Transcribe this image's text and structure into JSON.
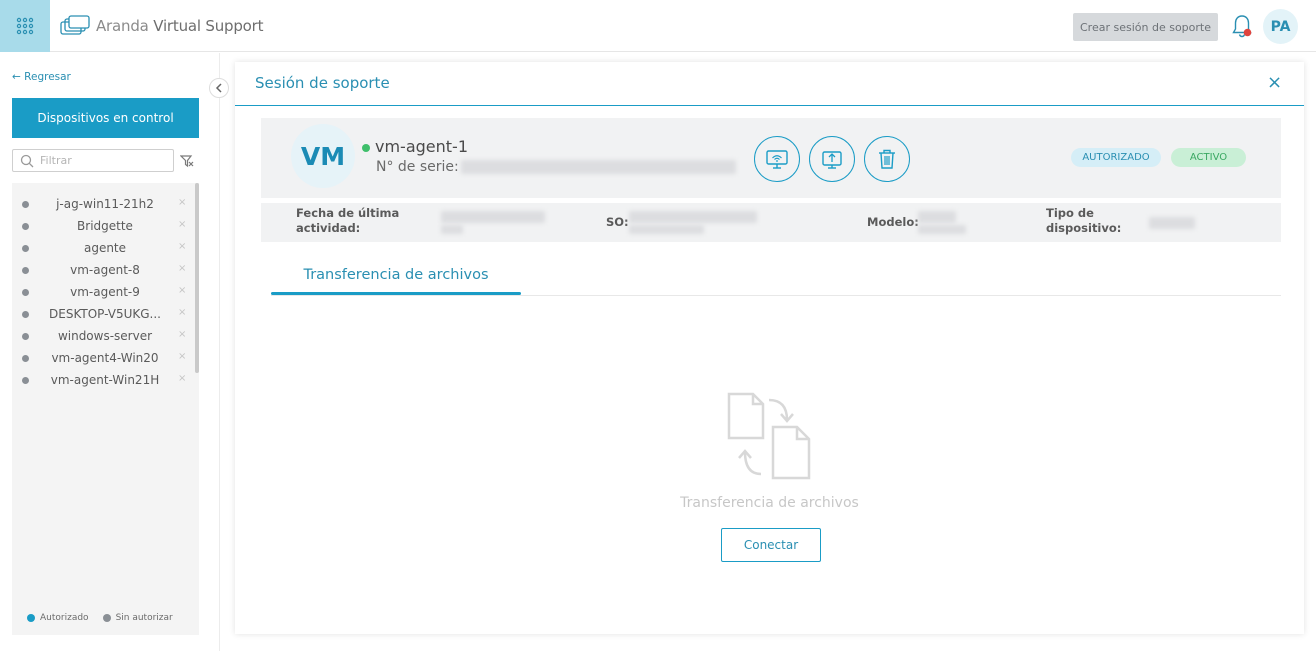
{
  "topbar": {
    "app_name_prefix": "Aranda",
    "app_name_suffix": "Virtual Support",
    "create_session_label": "Crear sesión de soporte",
    "user_initials": "PA"
  },
  "sidebar": {
    "back_label": "Regresar",
    "devices_button_label": "Dispositivos en control",
    "filter_placeholder": "Filtrar",
    "devices": [
      {
        "name": "j-ag-win11-21h2"
      },
      {
        "name": "Bridgette"
      },
      {
        "name": "agente"
      },
      {
        "name": "vm-agent-8"
      },
      {
        "name": "vm-agent-9"
      },
      {
        "name": "DESKTOP-V5UKG..."
      },
      {
        "name": "windows-server"
      },
      {
        "name": "vm-agent4-Win20"
      },
      {
        "name": "vm-agent-Win21H"
      }
    ],
    "legend": {
      "authorized_label": "Autorizado",
      "authorized_color": "#1a9cc6",
      "unauthorized_label": "Sin autorizar",
      "unauthorized_color": "#8a8f95"
    }
  },
  "session": {
    "title": "Sesión de soporte",
    "close_symbol": "×",
    "device": {
      "initials": "VM",
      "name": "vm-agent-1",
      "serial_label": "N° de serie:",
      "status_online_color": "#3fbf6b",
      "badge_authorized": "AUTORIZADO",
      "badge_active": "ACTIVO"
    },
    "actions": [
      {
        "icon": "remote-desktop-icon"
      },
      {
        "icon": "remote-upload-icon"
      },
      {
        "icon": "trash-icon"
      }
    ],
    "info": {
      "last_activity_label_1": "Fecha de última",
      "last_activity_label_2": "actividad:",
      "os_label": "SO:",
      "model_label": "Modelo:",
      "device_type_label_1": "Tipo de",
      "device_type_label_2": "dispositivo:"
    },
    "tabs": [
      {
        "label": "Transferencia de archivos",
        "active": true
      }
    ],
    "empty_state": {
      "icon": "file-transfer-icon",
      "text": "Transferencia de archivos",
      "connect_label": "Conectar"
    }
  },
  "colors": {
    "accent": "#1a9cc6",
    "apps_bg": "#a8dbea"
  }
}
